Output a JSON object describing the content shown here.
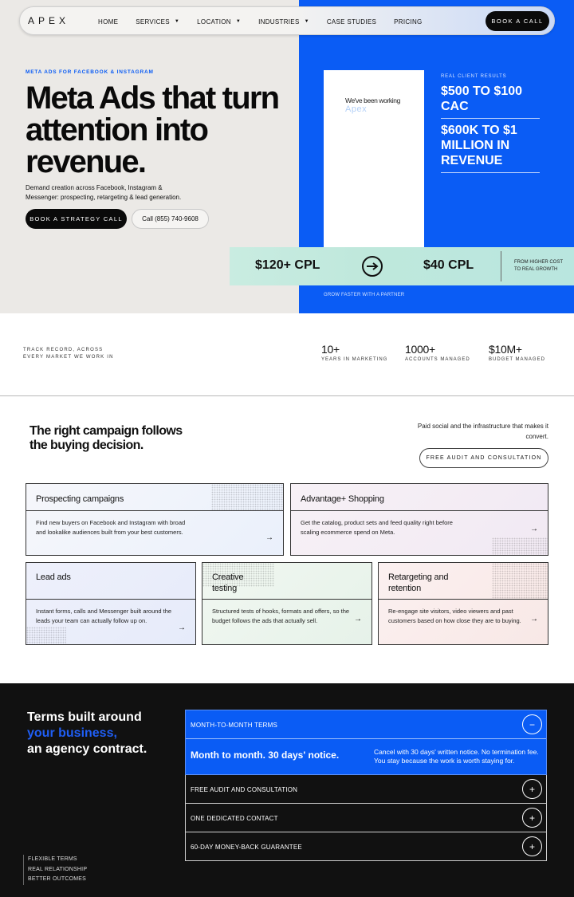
{
  "nav": {
    "logo": "APEX",
    "links": [
      {
        "label": "HOME",
        "has_caret": false
      },
      {
        "label": "SERVICES",
        "has_caret": true
      },
      {
        "label": "LOCATION",
        "has_caret": true
      },
      {
        "label": "INDUSTRIES",
        "has_caret": true
      },
      {
        "label": "CASE STUDIES",
        "has_caret": false
      },
      {
        "label": "PRICING",
        "has_caret": false
      }
    ],
    "cta": "BOOK A CALL",
    "caret_icon": "▼"
  },
  "hero": {
    "eyebrow": "META ADS FOR FACEBOOK & INSTAGRAM",
    "title": "Meta Ads that turn attention into revenue.",
    "subtitle": "Demand creation across Facebook, Instagram & Messenger: prospecting, retargeting & lead generation.",
    "primary_button": "BOOK A STRATEGY CALL",
    "secondary_button": "Call (855) 740-9608",
    "phone_text": "We've been working",
    "phone_logo": "Apex",
    "results_label": "REAL CLIENT RESULTS",
    "results": [
      "$500 TO $100 CAC",
      "$600K TO $1 MILLION IN REVENUE"
    ],
    "cpl_from": "$120+ CPL",
    "cpl_to": "$40 CPL",
    "cpl_note_line1": "FROM HIGHER COST",
    "cpl_note_line2": "TO REAL GROWTH",
    "footnote": "GROW FASTER WITH A PARTNER",
    "colors": {
      "accent": "#0a5cf5",
      "mint": "#c2e9de",
      "left_bg": "#ebe9e6"
    }
  },
  "stats": {
    "label_line1": "TRACK RECORD, ACROSS",
    "label_line2": "EVERY MARKET WE WORK IN",
    "items": [
      {
        "value": "10+",
        "label": "YEARS IN MARKETING"
      },
      {
        "value": "1000+",
        "label": "ACCOUNTS MANAGED"
      },
      {
        "value": "$10M+",
        "label": "BUDGET MANAGED"
      }
    ]
  },
  "services": {
    "title": "The right campaign follows the buying decision.",
    "intro": "Paid social and the infrastructure that makes it convert.",
    "cta": "FREE AUDIT AND CONSULTATION",
    "arrow_icon": "→",
    "cards": [
      {
        "title": "Prospecting campaigns",
        "body": "Find new buyers on Facebook and Instagram with broad and lookalike audiences built from your best customers."
      },
      {
        "title": "Advantage+ Shopping",
        "body": "Get the catalog, product sets and feed quality right before scaling ecommerce spend on Meta."
      },
      {
        "title": "Lead ads",
        "body": "Instant forms, calls and Messenger built around the leads your team can actually follow up on."
      },
      {
        "title": "Creative testing",
        "body": "Structured tests of hooks, formats and offers, so the budget follows the ads that actually sell."
      },
      {
        "title": "Retargeting and retention",
        "body": "Re-engage site visitors, video viewers and past customers based on how close they are to buying."
      }
    ]
  },
  "terms": {
    "title_line1": "Terms built around",
    "title_line2": "your business,",
    "title_line3": "an agency contract.",
    "side_items": [
      "FLEXIBLE TERMS",
      "REAL RELATIONSHIP",
      "BETTER OUTCOMES"
    ],
    "open_item": {
      "label": "MONTH-TO-MONTH TERMS",
      "heading": "Month to month. 30 days' notice.",
      "text": "Cancel with 30 days' written notice. No termination fee. You stay because the work is worth staying for.",
      "toggle": "−"
    },
    "collapsed_items": [
      {
        "label": "FREE AUDIT AND CONSULTATION",
        "toggle": "+"
      },
      {
        "label": "ONE DEDICATED CONTACT",
        "toggle": "+"
      },
      {
        "label": "60-DAY MONEY-BACK GUARANTEE",
        "toggle": "+"
      }
    ]
  }
}
